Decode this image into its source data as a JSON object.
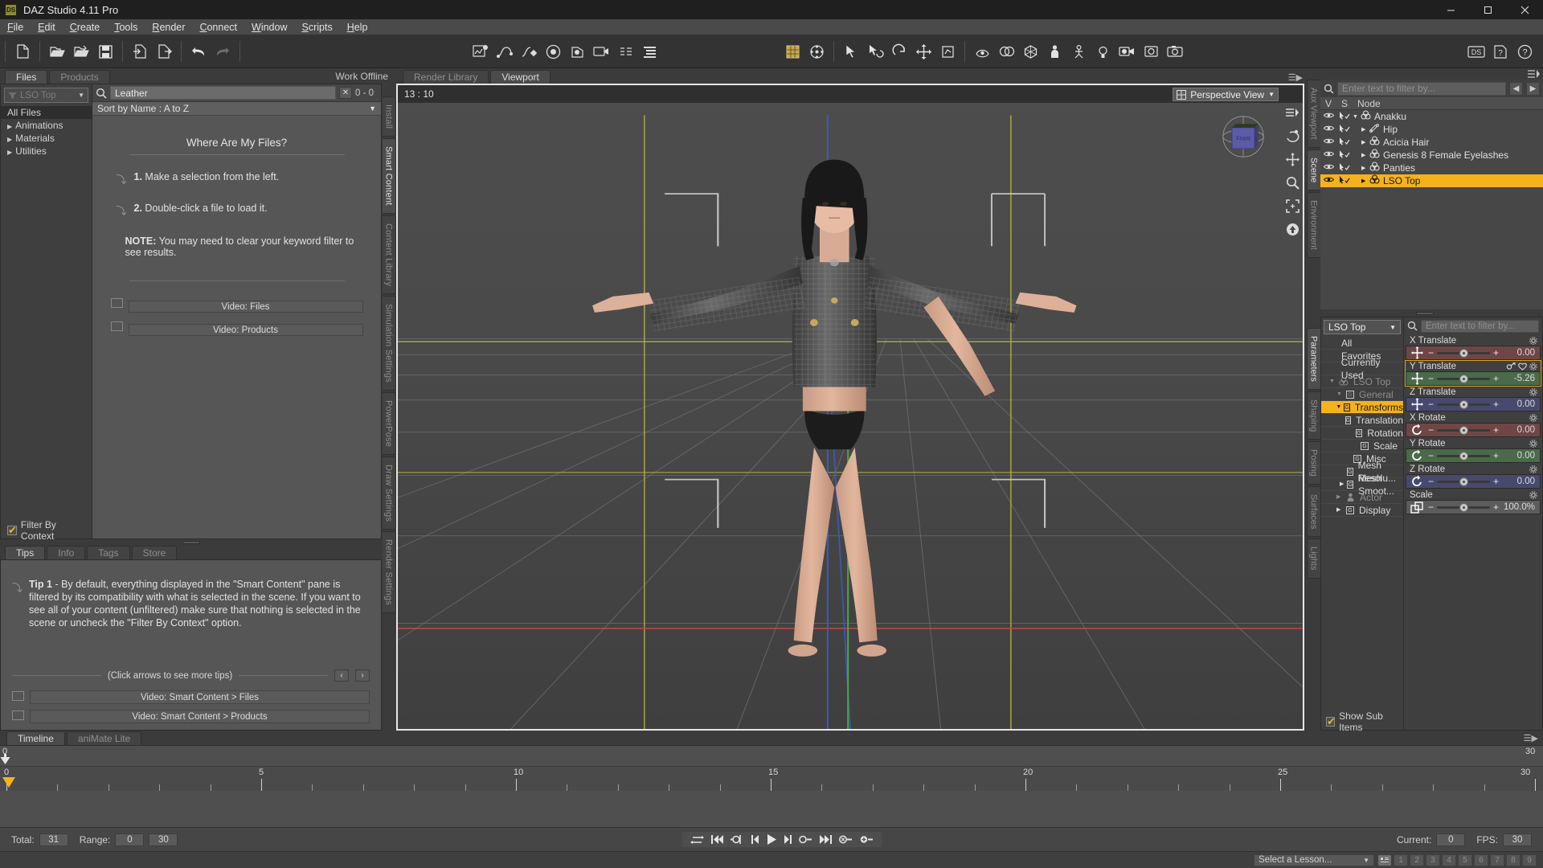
{
  "window": {
    "title": "DAZ Studio 4.11 Pro",
    "app_icon": "DS",
    "minimize": "─",
    "maximize": "☐",
    "close": "✕"
  },
  "menubar": [
    "File",
    "Edit",
    "Create",
    "Tools",
    "Render",
    "Connect",
    "Window",
    "Scripts",
    "Help"
  ],
  "toolbar": {
    "left_icons": [
      "new-file-icon",
      "open-folder-icon",
      "open-recent-icon",
      "save-icon",
      "import-icon",
      "export-icon",
      "undo-icon",
      "redo-icon"
    ],
    "mid_icons": [
      "puppeteer-icon",
      "spline-icon",
      "keyframe-icon",
      "render-settings-icon",
      "spot-render-icon",
      "camera-icon",
      "node-inspector-icon",
      "outline-icon"
    ],
    "right_icons": [
      "grid-icon",
      "joint-editor-icon",
      "select-tool-icon",
      "rotate-view-icon",
      "orbit-icon",
      "translate-icon",
      "pose-icon",
      "surface-icon",
      "morph-icon",
      "geometry-icon",
      "figure-icon",
      "mesh-icon",
      "light-icon",
      "camera2-icon",
      "render-icon",
      "snapshot-icon"
    ],
    "far_icons": [
      "daz-connect-icon",
      "help-icon",
      "about-icon"
    ]
  },
  "left_panel": {
    "tabs": [
      {
        "label": "Files",
        "active": true
      },
      {
        "label": "Products",
        "active": false
      }
    ],
    "work_offline": "Work Offline",
    "filter_button_label": "LSO Top",
    "categories": [
      {
        "label": "All Files",
        "selected": true,
        "arrow": false
      },
      {
        "label": "Animations",
        "selected": false,
        "arrow": true
      },
      {
        "label": "Materials",
        "selected": false,
        "arrow": true
      },
      {
        "label": "Utilities",
        "selected": false,
        "arrow": true
      }
    ],
    "filter_by_context": {
      "label": "Filter By Context",
      "checked": true
    },
    "search": {
      "value": "Leather",
      "placeholder": "",
      "clear_label": "✕",
      "count": "0 - 0"
    },
    "sort_label": "Sort by Name : A to Z",
    "where_are_my_files": {
      "title": "Where Are My Files?",
      "step1_num": "1.",
      "step1": "Make a selection from the left.",
      "step2_num": "2.",
      "step2": "Double-click a file to load it.",
      "note_label": "NOTE:",
      "note": "You may need to clear your keyword filter to see results.",
      "video_files": "Video: Files",
      "video_products": "Video:  Products"
    },
    "side_tabs": [
      {
        "label": "Install",
        "active": false
      },
      {
        "label": "Smart Content",
        "active": true
      },
      {
        "label": "Content Library",
        "active": false
      },
      {
        "label": "Simulation Settings",
        "active": false
      },
      {
        "label": "PowerPose",
        "active": false
      },
      {
        "label": "Draw Settings",
        "active": false
      },
      {
        "label": "Render Settings",
        "active": false
      }
    ]
  },
  "tips_panel": {
    "tabs": [
      {
        "label": "Tips",
        "active": true
      },
      {
        "label": "Info",
        "active": false
      },
      {
        "label": "Tags",
        "active": false
      },
      {
        "label": "Store",
        "active": false
      }
    ],
    "tip_label": "Tip 1",
    "tip_text": " - By default, everything displayed in the \"Smart Content\" pane is filtered by its compatibility with what is selected in the scene. If you want to see all of your content (unfiltered) make sure that nothing is selected in the scene or uncheck the \"Filter By Context\" option.",
    "click_arrows": "(Click arrows to see more tips)",
    "prev": "‹",
    "next": "›",
    "video_smart_files": "Video: Smart Content > Files",
    "video_smart_products": "Video: Smart Content > Products"
  },
  "viewport": {
    "tabs": [
      {
        "label": "Viewport",
        "active": true
      },
      {
        "label": "Render Library",
        "active": false
      }
    ],
    "fps_readout": "13 : 10",
    "camera": "Perspective View",
    "cube_label": "Front",
    "side_icons": [
      "view-options-icon",
      "orbit-camera-icon",
      "pan-camera-icon",
      "zoom-camera-icon",
      "frame-icon",
      "reset-camera-icon"
    ]
  },
  "scene_panel": {
    "filter_placeholder": "Enter text to filter by...",
    "nav_prev": "◀",
    "nav_next": "▶",
    "columns": [
      "V",
      "S",
      "Node"
    ],
    "nodes": [
      {
        "label": "Anakku",
        "indent": 0,
        "expanded": true,
        "icon": "figure-icon",
        "selected": false
      },
      {
        "label": "Hip",
        "indent": 1,
        "expanded": false,
        "icon": "bone-icon",
        "selected": false
      },
      {
        "label": "Acicia Hair",
        "indent": 1,
        "expanded": false,
        "icon": "figure-icon",
        "selected": false
      },
      {
        "label": "Genesis 8 Female Eyelashes",
        "indent": 1,
        "expanded": false,
        "icon": "figure-icon",
        "selected": false
      },
      {
        "label": "Panties",
        "indent": 1,
        "expanded": false,
        "icon": "figure-icon",
        "selected": false
      },
      {
        "label": "LSO Top",
        "indent": 1,
        "expanded": false,
        "icon": "figure-icon",
        "selected": true
      }
    ],
    "side_tabs": [
      {
        "label": "Aux Viewport",
        "active": false
      },
      {
        "label": "Scene",
        "active": true
      },
      {
        "label": "Environment",
        "active": false
      }
    ]
  },
  "parameters_panel": {
    "selector": "LSO Top",
    "tree": [
      {
        "label": "All",
        "level": 0,
        "icon": "",
        "dim": false,
        "hi": false,
        "arrow": ""
      },
      {
        "label": "Favorites",
        "level": 0,
        "icon": "",
        "dim": false,
        "hi": false,
        "arrow": ""
      },
      {
        "label": "Currently Used",
        "level": 0,
        "icon": "",
        "dim": false,
        "hi": false,
        "arrow": ""
      },
      {
        "label": "LSO Top",
        "level": 0,
        "icon": "figure",
        "dim": true,
        "hi": false,
        "arrow": "▼"
      },
      {
        "label": "General",
        "level": 1,
        "icon": "G",
        "dim": true,
        "hi": false,
        "arrow": "▼"
      },
      {
        "label": "Transforms",
        "level": 2,
        "icon": "G",
        "dim": false,
        "hi": true,
        "arrow": "▼"
      },
      {
        "label": "Translation",
        "level": 3,
        "icon": "G",
        "dim": false,
        "hi": false,
        "arrow": ""
      },
      {
        "label": "Rotation",
        "level": 3,
        "icon": "G",
        "dim": false,
        "hi": false,
        "arrow": ""
      },
      {
        "label": "Scale",
        "level": 3,
        "icon": "G",
        "dim": false,
        "hi": false,
        "arrow": ""
      },
      {
        "label": "Misc",
        "level": 2,
        "icon": "G",
        "dim": false,
        "hi": false,
        "arrow": ""
      },
      {
        "label": "Mesh Resolu...",
        "level": 2,
        "icon": "G",
        "dim": false,
        "hi": false,
        "arrow": ""
      },
      {
        "label": "Mesh Smoot...",
        "level": 2,
        "icon": "G",
        "dim": false,
        "hi": false,
        "arrow": "▶"
      },
      {
        "label": "Actor",
        "level": 1,
        "icon": "person",
        "dim": true,
        "hi": false,
        "arrow": "▶"
      },
      {
        "label": "Display",
        "level": 1,
        "icon": "G",
        "dim": false,
        "hi": false,
        "arrow": "▶"
      }
    ],
    "show_sub_items": {
      "label": "Show Sub Items",
      "checked": true
    },
    "filter_placeholder": "Enter text to filter by...",
    "properties": [
      {
        "name": "X Translate",
        "value": "0.00",
        "color": "#6e4646",
        "icon": "move-icon",
        "selected": false,
        "knob": 50
      },
      {
        "name": "Y Translate",
        "value": "-5.26",
        "color": "#4a6a4a",
        "icon": "move-icon",
        "selected": true,
        "knob": 50,
        "extra_icons": [
          "link-icon",
          "heart-icon",
          "gear-icon"
        ]
      },
      {
        "name": "Z Translate",
        "value": "0.00",
        "color": "#474a6e",
        "icon": "move-icon",
        "selected": false,
        "knob": 50
      },
      {
        "name": "X Rotate",
        "value": "0.00",
        "color": "#6e4646",
        "icon": "rotate-icon",
        "selected": false,
        "knob": 50
      },
      {
        "name": "Y Rotate",
        "value": "0.00",
        "color": "#4a6a4a",
        "icon": "rotate-icon",
        "selected": false,
        "knob": 50
      },
      {
        "name": "Z Rotate",
        "value": "0.00",
        "color": "#474a6e",
        "icon": "rotate-icon",
        "selected": false,
        "knob": 50
      },
      {
        "name": "Scale",
        "value": "100.0%",
        "color": "#5c5c5c",
        "icon": "scale-icon",
        "selected": false,
        "knob": 50
      }
    ],
    "side_tabs": [
      {
        "label": "Parameters",
        "active": true
      },
      {
        "label": "Shaping",
        "active": false
      },
      {
        "label": "Posing",
        "active": false
      },
      {
        "label": "Surfaces",
        "active": false
      },
      {
        "label": "Lights",
        "active": false
      }
    ]
  },
  "timeline": {
    "tabs": [
      {
        "label": "aniMate Lite",
        "active": false
      },
      {
        "label": "Timeline",
        "active": true
      }
    ],
    "top_ticks": [
      {
        "label": "0",
        "pos": 0
      },
      {
        "label": "30",
        "pos": 100
      }
    ],
    "ruler_labels": [
      "0",
      "5",
      "10",
      "15",
      "20",
      "25",
      "30"
    ],
    "ruler_values": [
      0,
      5,
      10,
      15,
      20,
      25,
      30
    ],
    "range_min": 0,
    "range_max": 30,
    "current_frame": 0
  },
  "statusbar": {
    "total_label": "Total:",
    "total_value": "31",
    "range_label": "Range:",
    "range_start": "0",
    "range_end": "30",
    "current_label": "Current:",
    "current_value": "0",
    "fps_label": "FPS:",
    "fps_value": "30",
    "transport": [
      "loop-icon",
      "first-frame-icon",
      "prev-key-icon",
      "prev-frame-icon",
      "play-icon",
      "next-frame-icon",
      "next-key-icon",
      "last-frame-icon",
      "delete-key-icon",
      "add-key-icon"
    ]
  },
  "lessonbar": {
    "select_lesson": "Select a Lesson...",
    "numbers": [
      "1",
      "2",
      "3",
      "4",
      "5",
      "6",
      "7",
      "8",
      "9"
    ],
    "lesson_icon": "lesson-icon"
  },
  "colors": {
    "accent": "#f5b21b",
    "window_bg": "#3b3b3b",
    "panel_bg": "#565656",
    "titlebar": "#1f1f1f"
  }
}
